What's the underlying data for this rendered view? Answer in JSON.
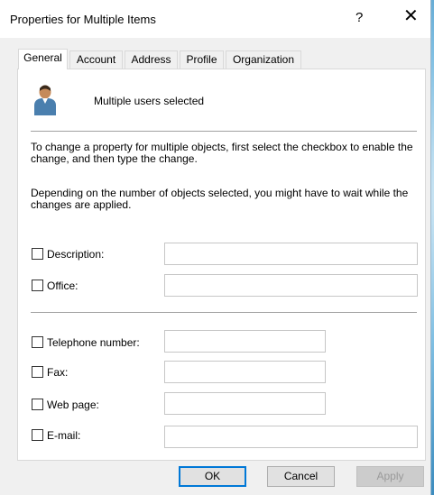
{
  "window": {
    "title": "Properties for Multiple Items",
    "help_glyph": "?",
    "close_glyph": "✕"
  },
  "tabs": [
    {
      "label": "General",
      "active": true
    },
    {
      "label": "Account",
      "active": false
    },
    {
      "label": "Address",
      "active": false
    },
    {
      "label": "Profile",
      "active": false
    },
    {
      "label": "Organization",
      "active": false
    }
  ],
  "general": {
    "selected_text": "Multiple users selected",
    "paragraph1": "To change a property for multiple objects, first select the checkbox to enable the change, and then type the change.",
    "paragraph2": "Depending on the number of objects selected, you might have to wait while the changes are applied.",
    "fields": {
      "description": {
        "label": "Description:",
        "checked": false,
        "value": ""
      },
      "office": {
        "label": "Office:",
        "checked": false,
        "value": ""
      },
      "telephone": {
        "label": "Telephone number:",
        "checked": false,
        "value": ""
      },
      "fax": {
        "label": "Fax:",
        "checked": false,
        "value": ""
      },
      "web_page": {
        "label": "Web page:",
        "checked": false,
        "value": ""
      },
      "email": {
        "label": "E-mail:",
        "checked": false,
        "value": ""
      }
    }
  },
  "buttons": {
    "ok": "OK",
    "cancel": "Cancel",
    "apply": "Apply"
  },
  "colors": {
    "accent": "#0078d7",
    "icon_person_body": "#4a7fae",
    "icon_person_head": "#c58a5a"
  }
}
